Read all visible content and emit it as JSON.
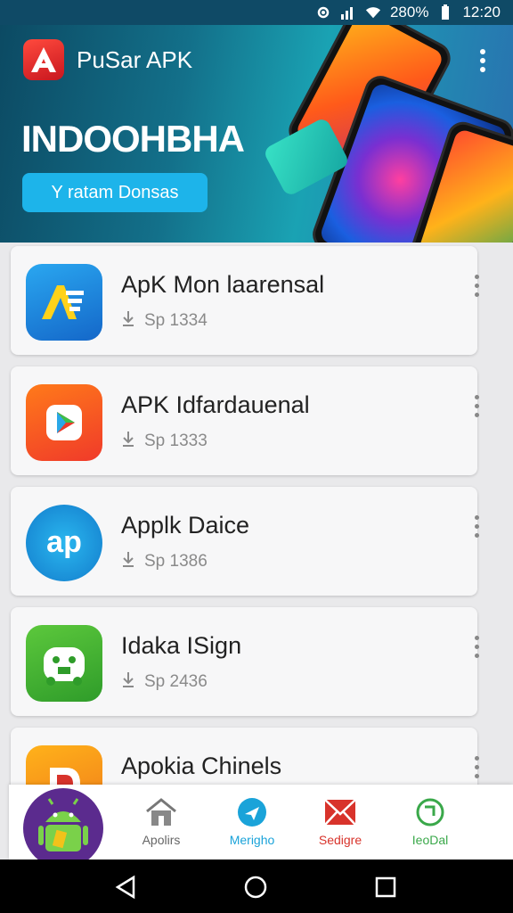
{
  "status_bar": {
    "battery": "280%",
    "time": "12:20"
  },
  "header": {
    "app_title": "PuSar APK",
    "hero_title": "INDOOHBHA",
    "hero_button": "Y ratam Donsas"
  },
  "apps": [
    {
      "name": "ApK Mon laarensal",
      "meta": "Sp 1334",
      "icon": "apk-a-icon",
      "color": "#1d8fe0"
    },
    {
      "name": "APK Idfardauenal",
      "meta": "Sp 1333",
      "icon": "play-icon",
      "color": "#f25a22"
    },
    {
      "name": "Applk Daice",
      "meta": "Sp 1386",
      "icon": "ap-logo-icon",
      "color": "#1b9ee0"
    },
    {
      "name": "Idaka ISign",
      "meta": "Sp 2436",
      "icon": "android-robot-icon",
      "color": "#45b236"
    },
    {
      "name": "Apokia Chinels",
      "meta": "",
      "icon": "d-logo-icon",
      "color": "#f2a61b"
    }
  ],
  "bottom_nav": {
    "items": [
      {
        "label": "Apolirs",
        "color": "#666666"
      },
      {
        "label": "Merigho",
        "color": "#1aa3d9"
      },
      {
        "label": "Sedigre",
        "color": "#d8332b"
      },
      {
        "label": "IeoDal",
        "color": "#3aa84a"
      }
    ]
  }
}
